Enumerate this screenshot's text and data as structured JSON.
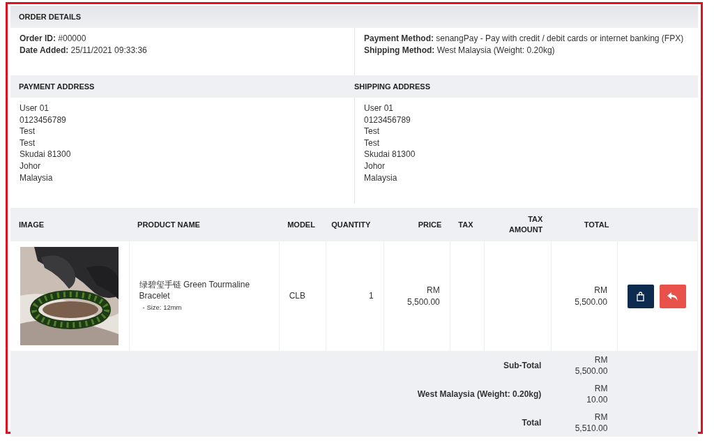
{
  "order_details": {
    "title": "ORDER DETAILS",
    "left": [
      "**Order ID:** #00000",
      "**Date Added:** 25/11/2021 09:33:36"
    ],
    "right": [
      "**Payment Method:** senangPay - Pay with credit / debit cards or internet banking (FPX)",
      "**Shipping Method:** West Malaysia (Weight: 0.20kg)"
    ]
  },
  "addresses": [
    {
      "title": "PAYMENT ADDRESS",
      "lines": [
        "User 01",
        "0123456789",
        "Test",
        "Test",
        "Skudai 81300",
        "Johor",
        "Malaysia"
      ]
    },
    {
      "title": "SHIPPING ADDRESS",
      "lines": [
        "User 01",
        "0123456789",
        "Test",
        "Test",
        "Skudai 81300",
        "Johor",
        "Malaysia"
      ]
    }
  ],
  "table": {
    "columns": [
      "IMAGE",
      "PRODUCT NAME",
      "MODEL",
      "QUANTITY",
      "PRICE",
      "TAX",
      "TAX AMOUNT",
      "TOTAL"
    ],
    "rows": [
      {
        "image": {
          "kind": "picture"
        },
        "name": "绿碧玺手链 Green Tourmaline Bracelet",
        "option": "- Size: 12mm",
        "model": "CLB",
        "quantity": "1",
        "price": "RM 5,500.00",
        "tax": "",
        "tax_amount": "",
        "total": "RM 5,500.00",
        "actions": [
          {
            "kind": "reorder",
            "color": "#0d2a4f"
          },
          {
            "kind": "return",
            "color": "#e9524a"
          }
        ]
      }
    ],
    "totals": [
      {
        "label": "Sub-Total",
        "value": "RM 5,500.00"
      },
      {
        "label": "West Malaysia (Weight: 0.20kg)",
        "value": "RM 10.00"
      },
      {
        "label": "Total",
        "value": "RM 5,510.00"
      }
    ]
  }
}
